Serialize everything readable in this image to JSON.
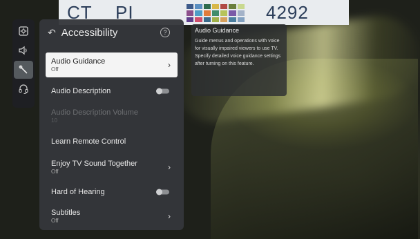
{
  "background": {
    "sheet_left_text": "CT",
    "sheet_mid_text": "PI",
    "sheet_number": "4292",
    "swatch_colors": [
      "#3d5a8a",
      "#5b8fc1",
      "#2e6b4d",
      "#d8b84a",
      "#b04a46",
      "#6a7f3c",
      "#c9d98f",
      "#8c4f8b",
      "#4f9dc6",
      "#e07c3c",
      "#3f8c6a",
      "#b7c35a",
      "#7a5aa8",
      "#a3b2c8",
      "#5e3e8c",
      "#cf4e6c",
      "#3b6b8c",
      "#9fb04a",
      "#d6a05c",
      "#4c7fa0",
      "#82a0c0"
    ]
  },
  "icon_bar": {
    "items": [
      {
        "icon": "picture-settings-icon",
        "active": false
      },
      {
        "icon": "sound-icon",
        "active": false
      },
      {
        "icon": "wrench-icon",
        "active": true
      },
      {
        "icon": "headset-support-icon",
        "active": false
      }
    ]
  },
  "panel": {
    "title": "Accessibility",
    "back_icon": "back-arrow-icon",
    "help_icon": "help-icon",
    "help_glyph": "?",
    "items": [
      {
        "label": "Audio Guidance",
        "sub": "Off",
        "control": "chevron",
        "selected": true,
        "disabled": false
      },
      {
        "label": "Audio Description",
        "sub": "",
        "control": "toggle",
        "selected": false,
        "disabled": false
      },
      {
        "label": "Audio Description Volume",
        "sub": "10",
        "control": "none",
        "selected": false,
        "disabled": true
      },
      {
        "label": "Learn Remote Control",
        "sub": "",
        "control": "none",
        "selected": false,
        "disabled": false
      },
      {
        "label": "Enjoy TV Sound Together",
        "sub": "Off",
        "control": "chevron",
        "selected": false,
        "disabled": false
      },
      {
        "label": "Hard of Hearing",
        "sub": "",
        "control": "toggle",
        "selected": false,
        "disabled": false
      },
      {
        "label": "Subtitles",
        "sub": "Off",
        "control": "chevron",
        "selected": false,
        "disabled": false
      }
    ]
  },
  "info_card": {
    "title": "Audio Guidance",
    "description": "Guide menus and operations with voice for visually impaired viewers to use TV. Specify detailed voice guidance settings after turning on this feature."
  }
}
